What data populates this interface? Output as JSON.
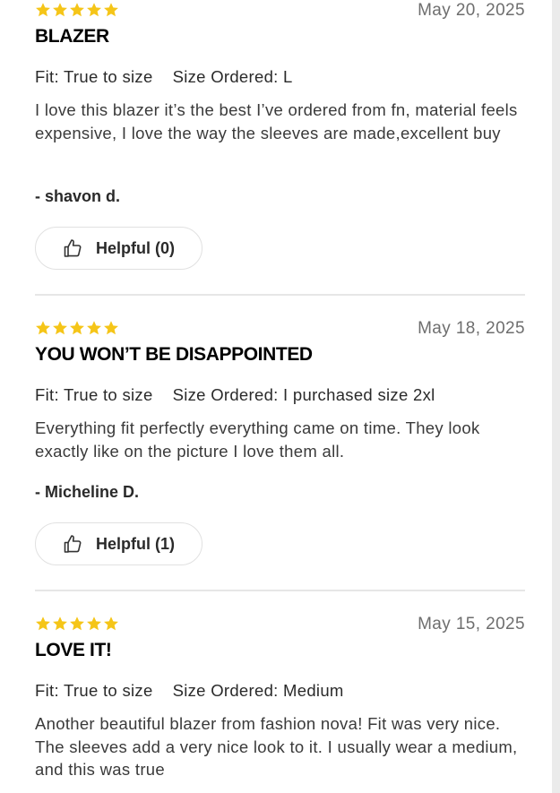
{
  "reviews": [
    {
      "stars": 5,
      "date": "May 20, 2025",
      "title": "BLAZER",
      "fit": "Fit: True to size",
      "size_ordered": "Size Ordered: L",
      "body": "I love this blazer it’s the best I’ve ordered from fn, material feels expensive, I love the way the sleeves are made,excellent buy",
      "author": "- shavon d.",
      "helpful_label": "Helpful (0)"
    },
    {
      "stars": 5,
      "date": "May 18, 2025",
      "title": "YOU WON’T BE DISAPPOINTED",
      "fit": "Fit: True to size",
      "size_ordered": "Size Ordered: I purchased size 2xl",
      "body": "Everything fit perfectly everything came on time. They look exactly like on the picture I love them all.",
      "author": "- Micheline D.",
      "helpful_label": "Helpful (1)"
    },
    {
      "stars": 5,
      "date": "May 15, 2025",
      "title": "LOVE IT!",
      "fit": "Fit: True to size",
      "size_ordered": "Size Ordered: Medium",
      "body": "Another beautiful blazer from fashion nova! Fit was very nice. The sleeves add a very nice look to it. I usually wear a medium, and this was true",
      "author": "",
      "helpful_label": ""
    }
  ],
  "colors": {
    "star": "#f5c518",
    "divider": "#e6e6e6"
  },
  "icons": {
    "star": "star-icon",
    "helpful": "thumbs-up-icon"
  }
}
